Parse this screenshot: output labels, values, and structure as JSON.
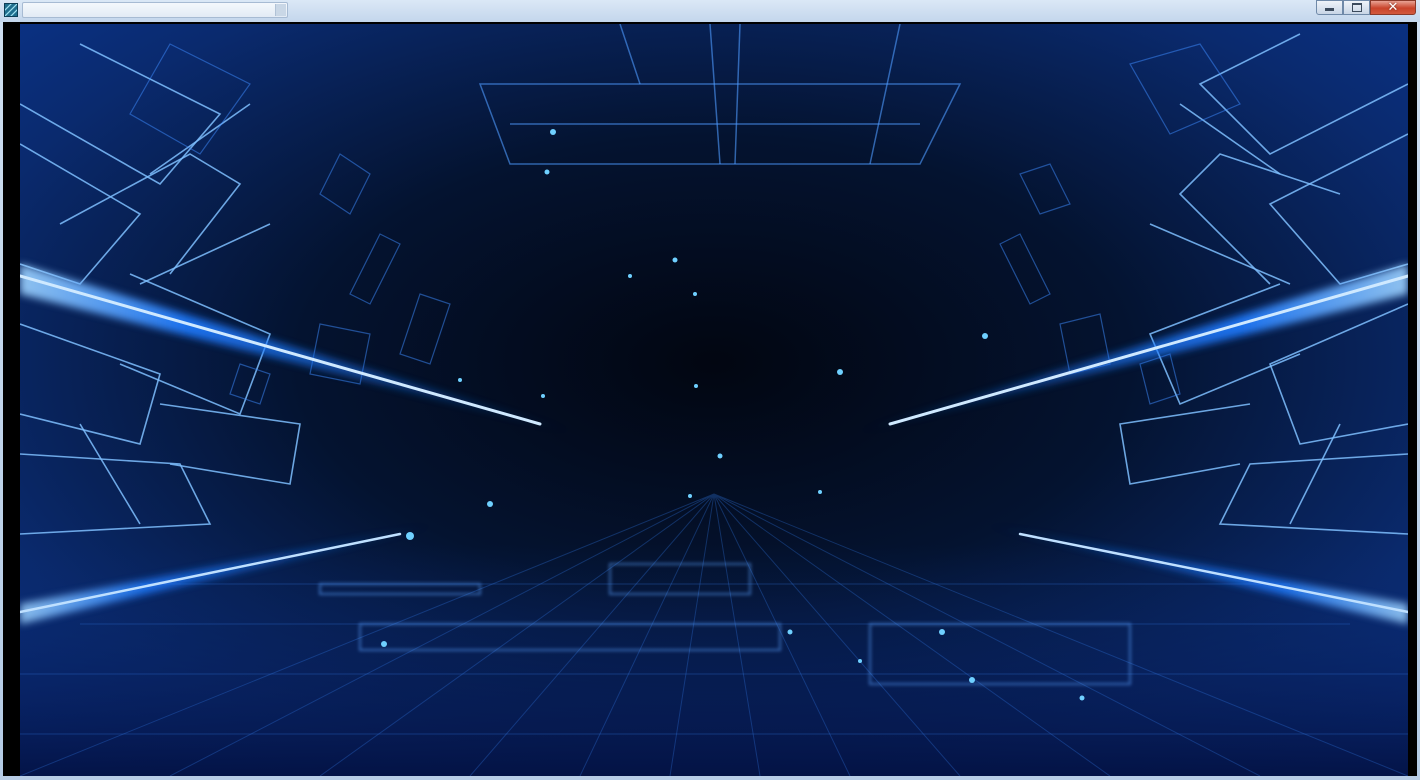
{
  "window": {
    "title": "",
    "controls": {
      "minimize": "minimize",
      "maximize": "maximize",
      "close": "close"
    }
  },
  "content": {
    "background": "blue-tech-tunnel-image"
  },
  "colors": {
    "accent": "#1e7bff",
    "glow": "#6fb6ff",
    "deep": "#020a1f",
    "close": "#c9442b"
  }
}
